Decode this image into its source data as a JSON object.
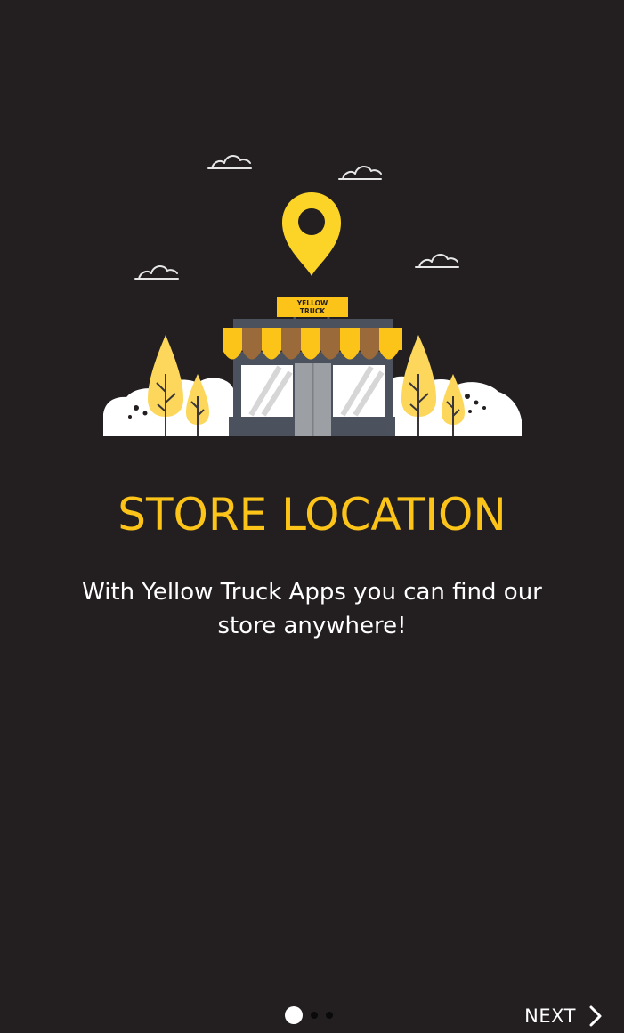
{
  "onboarding": {
    "title": "STORE LOCATION",
    "subtitle": "With Yellow Truck Apps you can find our store anywhere!",
    "sign_line_1": "YELLOW",
    "sign_line_2": "TRUCK"
  },
  "pager": {
    "current_page": 1,
    "page_count": 3
  },
  "footer": {
    "next_label": "NEXT",
    "next_icon": "chevron-right-icon"
  },
  "colors": {
    "background": "#231f20",
    "accent_yellow": "#fcc419",
    "text_white": "#ffffff"
  }
}
